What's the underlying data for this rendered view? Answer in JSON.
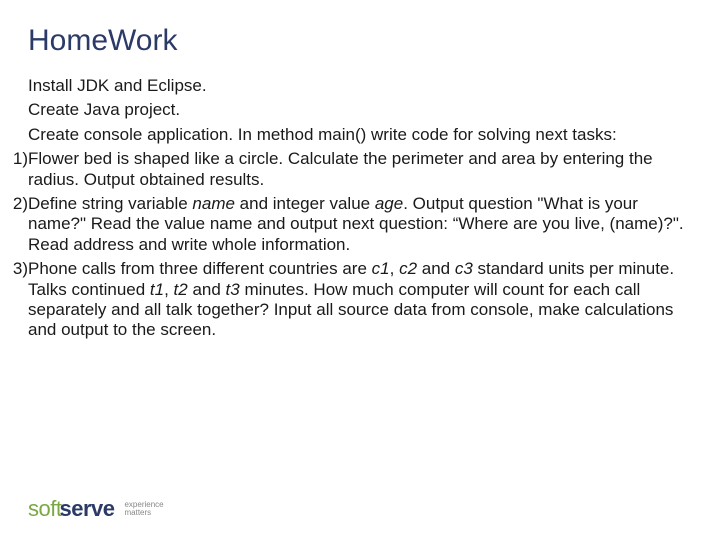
{
  "title": "HomeWork",
  "intro": {
    "line1": "Install JDK and Eclipse.",
    "line2": "Create Java project.",
    "line3": "Create console application. In method main() write code for solving next tasks:"
  },
  "tasks": [
    {
      "num": "1)",
      "text_before": "Flower bed is shaped like a circle. Calculate the perimeter and area by entering the radius. Output obtained results."
    },
    {
      "num": "2)",
      "text_parts": [
        {
          "t": "Define string variable "
        },
        {
          "t": "name",
          "i": true
        },
        {
          "t": " and integer value "
        },
        {
          "t": "age",
          "i": true
        },
        {
          "t": ". Output question \"What is your name?\" Read the value name and output next question: “Where are you live, (name)?\". Read address and write whole information."
        }
      ]
    },
    {
      "num": "3)",
      "text_parts": [
        {
          "t": "Phone calls from three different countries are "
        },
        {
          "t": "c1",
          "i": true
        },
        {
          "t": ", "
        },
        {
          "t": "c2",
          "i": true
        },
        {
          "t": " and "
        },
        {
          "t": "c3",
          "i": true
        },
        {
          "t": " standard units per minute. Talks continued "
        },
        {
          "t": "t1",
          "i": true
        },
        {
          "t": ", "
        },
        {
          "t": "t2",
          "i": true
        },
        {
          "t": " and "
        },
        {
          "t": "t3",
          "i": true
        },
        {
          "t": " minutes. How much computer will count for each call separately and all talk together? Input all source data from console, make calculations and output to the screen."
        }
      ]
    }
  ],
  "footer": {
    "brand_soft": "soft",
    "brand_serve": "serve",
    "tag1": "experience",
    "tag2": "matters"
  }
}
